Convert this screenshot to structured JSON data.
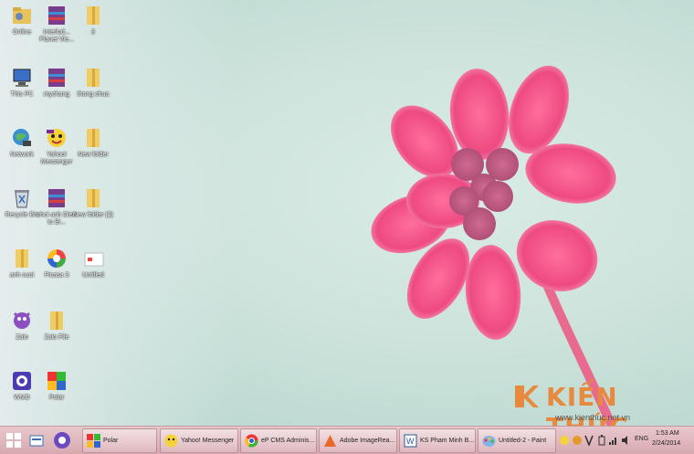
{
  "desktop": {
    "icons": [
      {
        "label": "Online",
        "icon": "folder-user-icon"
      },
      {
        "label": "Interlud... Planet Vie...",
        "icon": "winrar-archive-icon"
      },
      {
        "label": "3",
        "icon": "folder-icon"
      },
      {
        "label": "This PC",
        "icon": "this-pc-icon"
      },
      {
        "label": "mychang",
        "icon": "winrar-archive-icon"
      },
      {
        "label": "thong chua",
        "icon": "folder-icon"
      },
      {
        "label": "Network",
        "icon": "network-icon"
      },
      {
        "label": "Yahoo! Messenger",
        "icon": "yahoo-messenger-icon"
      },
      {
        "label": "New folder",
        "icon": "folder-icon"
      },
      {
        "label": "Recycle Bin",
        "icon": "recycle-bin-icon"
      },
      {
        "label": "choi anh Dien tu Bi...",
        "icon": "winrar-archive-icon"
      },
      {
        "label": "New folder (2)",
        "icon": "folder-icon"
      },
      {
        "label": "anh cuoi",
        "icon": "folder-icon"
      },
      {
        "label": "Picasa 3",
        "icon": "picasa-icon"
      },
      {
        "label": "Untitled",
        "icon": "image-file-icon"
      },
      {
        "label": "Zalo",
        "icon": "cat-app-icon"
      },
      {
        "label": "Zalo File",
        "icon": "folder-icon"
      },
      {
        "label": "WMD",
        "icon": "app-icon"
      },
      {
        "label": "Polar",
        "icon": "polar-icon"
      }
    ]
  },
  "watermark": {
    "brand": "KIẾN THỨC",
    "url": "www.kienthuc.net.vn",
    "color": "#e78a3f"
  },
  "taskbar": {
    "start_icon": "windows-start-icon",
    "buttons": [
      {
        "label": "Polar",
        "icon": "polar-icon"
      },
      {
        "label": "Yahoo! Messenger",
        "icon": "yahoo-messenger-icon"
      },
      {
        "label": "eP CMS Adminis...",
        "icon": "chrome-icon"
      },
      {
        "label": "Adobe ImageRea...",
        "icon": "adobe-icon"
      },
      {
        "label": "KS Pham Minh B...",
        "icon": "word-icon"
      },
      {
        "label": "Untitled-2 - Paint",
        "icon": "paint-icon"
      }
    ],
    "tray": {
      "lang": "ENG",
      "time": "1:53 AM",
      "date": "2/24/2014"
    },
    "color": "#dcb0b6"
  }
}
